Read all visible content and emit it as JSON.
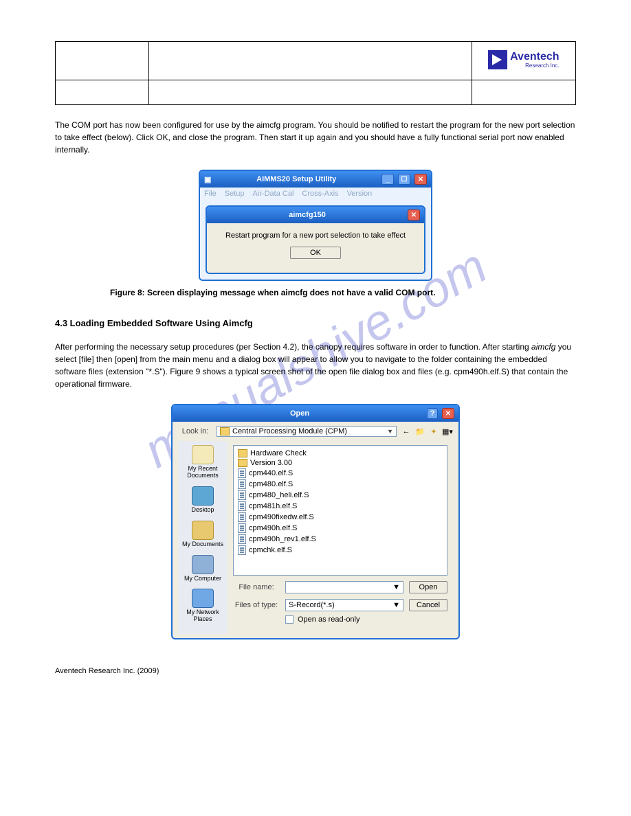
{
  "watermark": "manualshive.com",
  "header": {
    "logo_name": "Aventech",
    "logo_sub": "Research Inc."
  },
  "para1": "The COM port has now been configured for use by the aimcfg program. You should be notified to restart the program for the new port selection to take effect (below). Click OK, and close the program. Then start it up again and you should have a fully functional serial port now enabled internally.",
  "fig8": {
    "window_title": "AIMMS20 Setup Utility",
    "menu": [
      "File",
      "Setup",
      "Air-Data Cal",
      "Cross-Axis",
      "Version"
    ],
    "dlg_title": "aimcfg150",
    "dlg_msg": "Restart program for a new port selection to take effect",
    "ok": "OK",
    "caption": "Figure 8: Screen displaying message when aimcfg does not have a valid COM port."
  },
  "section_title": "4.3 Loading Embedded Software Using Aimcfg",
  "para2_a": "After performing the necessary setup procedures (per Section 4.2), the canopy requires software in order to function. After starting ",
  "para2_b": " you select [file] then [open] from the main menu and a dialog box will appear to allow you to navigate to the folder containing the embedded software files (extension \"*.S\"). Figure 9 shows a typical screen shot of the open file dialog box and files (e.g. cpm490h.elf.S) that contain the operational firmware.",
  "aimcfg_name": "aimcfg",
  "fig9": {
    "title": "Open",
    "lookin_label": "Look in:",
    "lookin_value": "Central Processing Module (CPM)",
    "toolbar_icons": [
      "←",
      "folder-up",
      "new-folder",
      "views"
    ],
    "places": [
      "My Recent Documents",
      "Desktop",
      "My Documents",
      "My Computer",
      "My Network Places"
    ],
    "folders": [
      "Hardware Check",
      "Version 3.00"
    ],
    "files": [
      "cpm440.elf.S",
      "cpm480.elf.S",
      "cpm480_heli.elf.S",
      "cpm481h.elf.S",
      "cpm490fixedw.elf.S",
      "cpm490h.elf.S",
      "cpm490h_rev1.elf.S",
      "cpmchk.elf.S"
    ],
    "filename_label": "File name:",
    "filename_value": "",
    "filetype_label": "Files of type:",
    "filetype_value": "S-Record(*.s)",
    "readonly_label": "Open as read-only",
    "open_btn": "Open",
    "cancel_btn": "Cancel"
  },
  "footer": "Aventech Research Inc. (2009)"
}
